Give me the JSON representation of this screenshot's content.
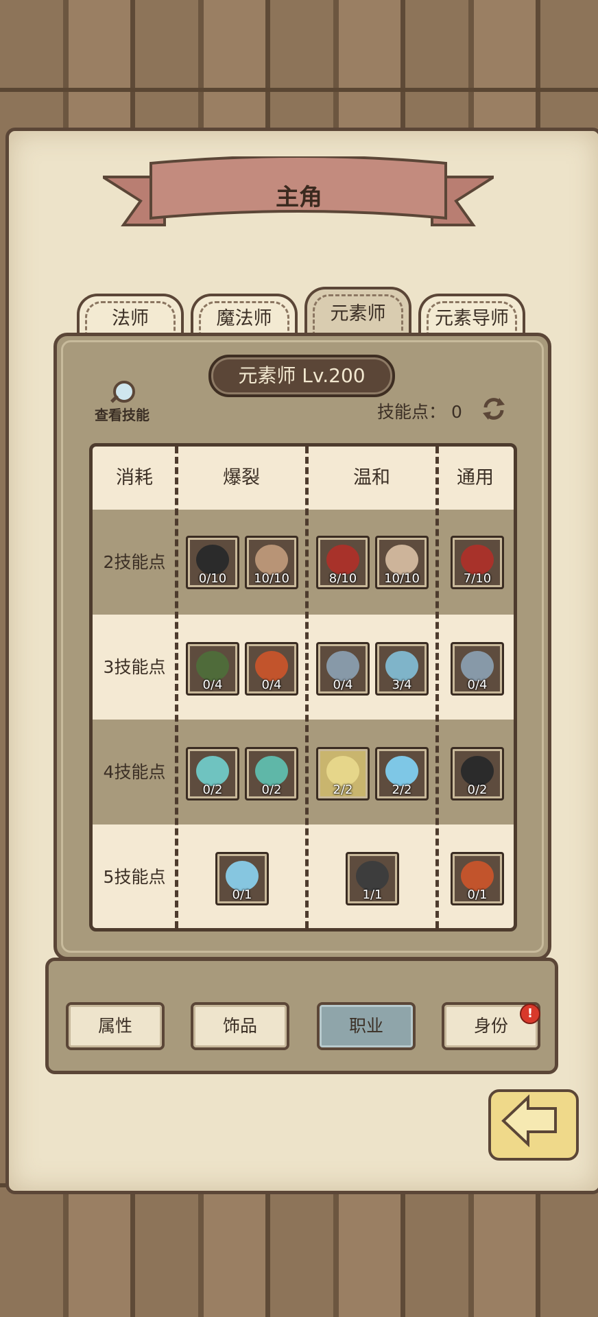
{
  "header": {
    "title": "主角"
  },
  "tabs": [
    {
      "label": "法师",
      "active": false
    },
    {
      "label": "魔法师",
      "active": false
    },
    {
      "label": "元素师",
      "active": true
    },
    {
      "label": "元素导师",
      "active": false
    }
  ],
  "panel": {
    "class_level": "元素师 Lv.200",
    "view_skills_label": "查看技能",
    "skill_points_label": "技能点：",
    "skill_points_value": "0"
  },
  "grid": {
    "columns": [
      "消耗",
      "爆裂",
      "温和",
      "通用"
    ],
    "rows": [
      {
        "label": "2技能点",
        "skills": {
          "burst": [
            {
              "icon": "bomb-skull-icon",
              "level": "0/10"
            },
            {
              "icon": "scroll-hand-icon",
              "level": "10/10"
            }
          ],
          "gentle": [
            {
              "icon": "heart-icon",
              "level": "8/10"
            },
            {
              "icon": "arm-icon",
              "level": "10/10"
            }
          ],
          "general": [
            {
              "icon": "heart-up-icon",
              "level": "7/10"
            }
          ]
        }
      },
      {
        "label": "3技能点",
        "skills": {
          "burst": [
            {
              "icon": "sprout-icon",
              "level": "0/4"
            },
            {
              "icon": "splat-skull-icon",
              "level": "0/4"
            }
          ],
          "gentle": [
            {
              "icon": "broken-shield-icon",
              "level": "0/4"
            },
            {
              "icon": "tornado-icon",
              "level": "3/4"
            }
          ],
          "general": [
            {
              "icon": "broken-shield-up-icon",
              "level": "0/4"
            }
          ]
        }
      },
      {
        "label": "4技能点",
        "skills": {
          "burst": [
            {
              "icon": "whirlwind-icon",
              "level": "0/2"
            },
            {
              "icon": "cloud-icon",
              "level": "0/2"
            }
          ],
          "gentle": [
            {
              "icon": "mountain-icon",
              "level": "2/2"
            },
            {
              "icon": "ice-shield-icon",
              "level": "2/2"
            }
          ],
          "general": [
            {
              "icon": "bomb-up-icon",
              "level": "0/2"
            }
          ]
        }
      },
      {
        "label": "5技能点",
        "skills": {
          "burst": [
            {
              "icon": "ice-shards-icon",
              "level": "0/1"
            }
          ],
          "gentle": [
            {
              "icon": "lasso-icon",
              "level": "1/1"
            }
          ],
          "general": [
            {
              "icon": "explosion-up-icon",
              "level": "0/1"
            }
          ]
        }
      }
    ]
  },
  "bottom_nav": [
    {
      "label": "属性",
      "active": false
    },
    {
      "label": "饰品",
      "active": false
    },
    {
      "label": "职业",
      "active": true
    },
    {
      "label": "身份",
      "active": false,
      "alert": "!"
    }
  ],
  "colors": {
    "wood": "#8d7459",
    "paper": "#ede3c9",
    "panel": "#a89a7c",
    "outline": "#5b4637",
    "active_tab": "#8fa5aa",
    "alert": "#d8392b"
  }
}
